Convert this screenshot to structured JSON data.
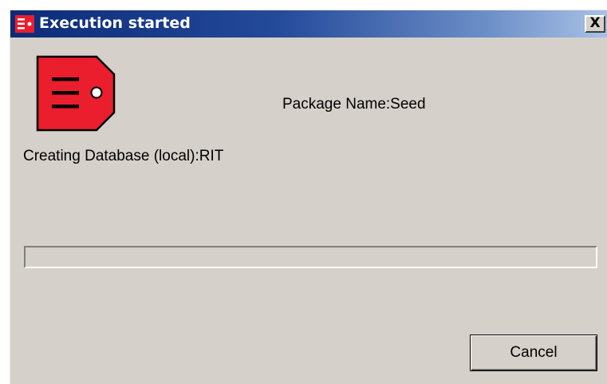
{
  "window": {
    "title": "Execution started",
    "close_label": "X",
    "title_icon": "app-logo-icon"
  },
  "content": {
    "icon": "package-tag-icon",
    "package_name": "Package Name:Seed",
    "status": "Creating Database (local):RIT",
    "progress_fraction": 0
  },
  "buttons": {
    "cancel_label": "Cancel"
  },
  "colors": {
    "titlebar_start": "#0b2b78",
    "titlebar_end": "#a9c2e6",
    "icon_red": "#ea1e2d",
    "dialog_bg": "#d5d1ca"
  }
}
